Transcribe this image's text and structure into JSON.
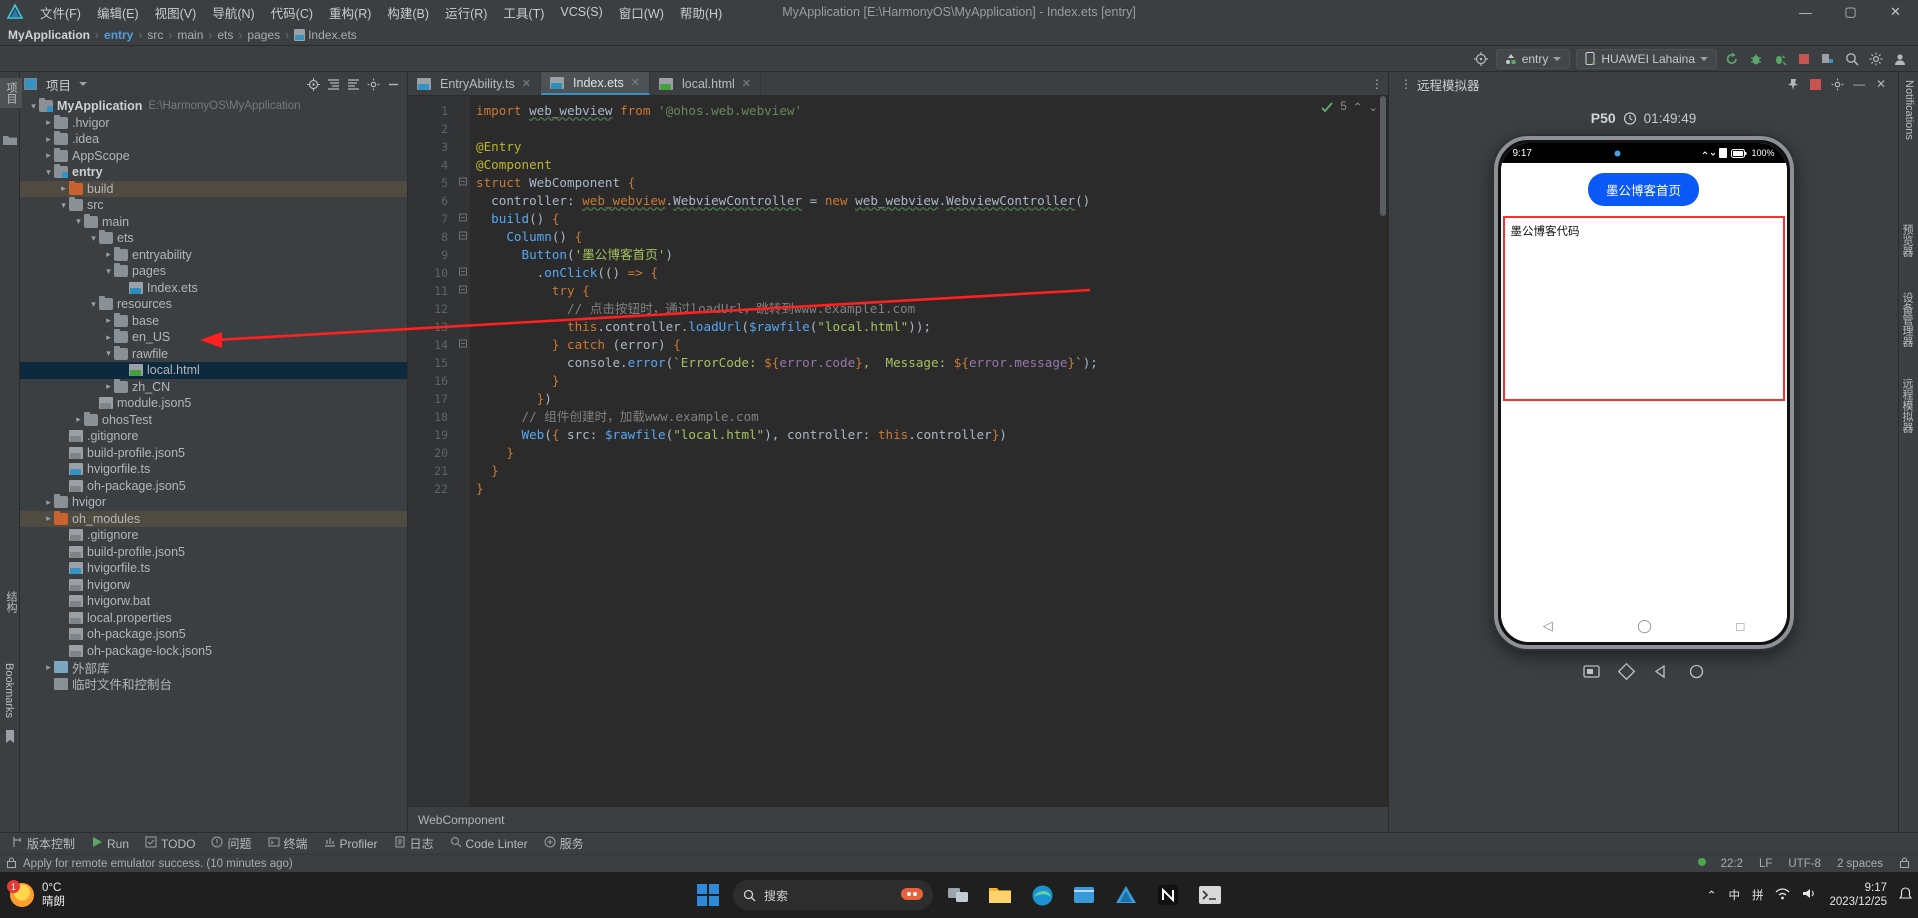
{
  "window": {
    "title": "MyApplication [E:\\HarmonyOS\\MyApplication] - Index.ets [entry]",
    "minimize": "—",
    "maximize": "▢",
    "close": "✕"
  },
  "menubar": {
    "logo_name": "deveco-logo-icon",
    "items": [
      {
        "label": "文件(F)"
      },
      {
        "label": "编辑(E)"
      },
      {
        "label": "视图(V)"
      },
      {
        "label": "导航(N)"
      },
      {
        "label": "代码(C)"
      },
      {
        "label": "重构(R)"
      },
      {
        "label": "构建(B)"
      },
      {
        "label": "运行(R)"
      },
      {
        "label": "工具(T)"
      },
      {
        "label": "VCS(S)"
      },
      {
        "label": "窗口(W)"
      },
      {
        "label": "帮助(H)"
      }
    ]
  },
  "breadcrumb": {
    "items": [
      "MyApplication",
      "entry",
      "src",
      "main",
      "ets",
      "pages",
      "Index.ets"
    ],
    "separator": "›"
  },
  "toolbar": {
    "run_config": "entry",
    "device": "HUAWEI Lahaina",
    "icons": [
      "target-icon",
      "run-icon",
      "debug-icon",
      "profile-run-icon",
      "stop-icon",
      "device-manager-icon",
      "search-icon",
      "settings-icon",
      "account-icon"
    ]
  },
  "left_strip": {
    "tab_project": "项目",
    "bookmarks": "Bookmarks",
    "structure": "结构"
  },
  "right_strip": {
    "notifications": "Notifications",
    "previewer": "预览器",
    "device_mgr": "设备管理器",
    "remote_emulator": "远程模拟器"
  },
  "project_panel": {
    "title": "项目",
    "header_icons": [
      "locate-icon",
      "collapse-all-icon",
      "expand-all-icon",
      "settings-icon",
      "hide-icon"
    ],
    "tree": [
      {
        "depth": 0,
        "arrow": "v",
        "icon": "folder-module",
        "label": "MyApplication",
        "bold": true,
        "path": "E:\\HarmonyOS\\MyApplication"
      },
      {
        "depth": 1,
        "arrow": ">",
        "icon": "folder",
        "label": ".hvigor"
      },
      {
        "depth": 1,
        "arrow": ">",
        "icon": "folder",
        "label": ".idea"
      },
      {
        "depth": 1,
        "arrow": ">",
        "icon": "folder",
        "label": "AppScope"
      },
      {
        "depth": 1,
        "arrow": "v",
        "icon": "folder-module",
        "label": "entry",
        "bold": true
      },
      {
        "depth": 2,
        "arrow": ">",
        "icon": "folder-orange",
        "label": "build",
        "highlight": true
      },
      {
        "depth": 2,
        "arrow": "v",
        "icon": "folder",
        "label": "src"
      },
      {
        "depth": 3,
        "arrow": "v",
        "icon": "folder",
        "label": "main"
      },
      {
        "depth": 4,
        "arrow": "v",
        "icon": "folder",
        "label": "ets"
      },
      {
        "depth": 5,
        "arrow": ">",
        "icon": "folder",
        "label": "entryability"
      },
      {
        "depth": 5,
        "arrow": "v",
        "icon": "folder",
        "label": "pages"
      },
      {
        "depth": 6,
        "arrow": "",
        "icon": "file-ets",
        "label": "Index.ets"
      },
      {
        "depth": 4,
        "arrow": "v",
        "icon": "folder",
        "label": "resources"
      },
      {
        "depth": 5,
        "arrow": ">",
        "icon": "folder",
        "label": "base"
      },
      {
        "depth": 5,
        "arrow": ">",
        "icon": "folder",
        "label": "en_US"
      },
      {
        "depth": 5,
        "arrow": "v",
        "icon": "folder",
        "label": "rawfile"
      },
      {
        "depth": 6,
        "arrow": "",
        "icon": "file-html",
        "label": "local.html",
        "selected": true
      },
      {
        "depth": 5,
        "arrow": ">",
        "icon": "folder",
        "label": "zh_CN"
      },
      {
        "depth": 4,
        "arrow": "",
        "icon": "file-json",
        "label": "module.json5"
      },
      {
        "depth": 3,
        "arrow": ">",
        "icon": "folder",
        "label": "ohosTest"
      },
      {
        "depth": 2,
        "arrow": "",
        "icon": "file-json",
        "label": ".gitignore"
      },
      {
        "depth": 2,
        "arrow": "",
        "icon": "file-json",
        "label": "build-profile.json5"
      },
      {
        "depth": 2,
        "arrow": "",
        "icon": "file-ts",
        "label": "hvigorfile.ts"
      },
      {
        "depth": 2,
        "arrow": "",
        "icon": "file-json",
        "label": "oh-package.json5"
      },
      {
        "depth": 1,
        "arrow": ">",
        "icon": "folder",
        "label": "hvigor"
      },
      {
        "depth": 1,
        "arrow": ">",
        "icon": "folder-orange",
        "label": "oh_modules",
        "highlight": true
      },
      {
        "depth": 2,
        "arrow": "",
        "icon": "file-json",
        "label": ".gitignore"
      },
      {
        "depth": 2,
        "arrow": "",
        "icon": "file-json",
        "label": "build-profile.json5"
      },
      {
        "depth": 2,
        "arrow": "",
        "icon": "file-ts",
        "label": "hvigorfile.ts"
      },
      {
        "depth": 2,
        "arrow": "",
        "icon": "file-plain",
        "label": "hvigorw"
      },
      {
        "depth": 2,
        "arrow": "",
        "icon": "file-plain",
        "label": "hvigorw.bat"
      },
      {
        "depth": 2,
        "arrow": "",
        "icon": "file-plain",
        "label": "local.properties"
      },
      {
        "depth": 2,
        "arrow": "",
        "icon": "file-json",
        "label": "oh-package.json5"
      },
      {
        "depth": 2,
        "arrow": "",
        "icon": "file-json",
        "label": "oh-package-lock.json5"
      },
      {
        "depth": 1,
        "arrow": ">",
        "icon": "lib",
        "label": "外部库"
      },
      {
        "depth": 1,
        "arrow": "",
        "icon": "scratch",
        "label": "临时文件和控制台"
      }
    ]
  },
  "editor": {
    "tabs": [
      {
        "label": "EntryAbility.ts",
        "icon": "file-ts",
        "active": false,
        "close": "✕"
      },
      {
        "label": "Index.ets",
        "icon": "file-ets",
        "active": true,
        "close": "✕"
      },
      {
        "label": "local.html",
        "icon": "file-html",
        "active": false,
        "close": "✕"
      }
    ],
    "inspection": {
      "count": "5",
      "up": "⌃",
      "down": "⌄"
    },
    "line_numbers": [
      "1",
      "2",
      "3",
      "4",
      "5",
      "6",
      "7",
      "8",
      "9",
      "10",
      "11",
      "12",
      "13",
      "14",
      "15",
      "16",
      "17",
      "18",
      "19",
      "20",
      "21",
      "22"
    ],
    "code_lines": [
      "import web_webview from '@ohos.web.webview'",
      "",
      "@Entry",
      "@Component",
      "struct WebComponent {",
      "  controller: web_webview.WebviewController = new web_webview.WebviewController()",
      "  build() {",
      "    Column() {",
      "      Button('墨公博客首页')",
      "        .onClick(() => {",
      "          try {",
      "            // 点击按钮时，通过loadUrl，跳转到www.example1.com",
      "            this.controller.loadUrl($rawfile(\"local.html\"));",
      "          } catch (error) {",
      "            console.error(`ErrorCode: ${error.code},  Message: ${error.message}`);",
      "          }",
      "        })",
      "      // 组件创建时，加载www.example.com",
      "      Web({ src: $rawfile(\"local.html\"), controller: this.controller})",
      "    }",
      "  }",
      "}"
    ],
    "breadcrumb_bottom": "WebComponent"
  },
  "emulator": {
    "panel_title": "远程模拟器",
    "device_name": "P50",
    "session_time": "01:49:49",
    "phone": {
      "status_time": "9:17",
      "battery": "100%",
      "button_label": "墨公博客首页",
      "webview_text": "墨公博客代码",
      "nav": [
        "◁",
        "◯",
        "□"
      ]
    },
    "tool_icons": [
      "screenshot-icon",
      "rotate-icon",
      "back-icon",
      "home-icon"
    ]
  },
  "bottom_bar": {
    "items": [
      {
        "label": "版本控制",
        "icon": "vcs-icon"
      },
      {
        "label": "Run",
        "icon": "run-icon"
      },
      {
        "label": "TODO",
        "icon": "todo-icon"
      },
      {
        "label": "问题",
        "icon": "problems-icon"
      },
      {
        "label": "终端",
        "icon": "terminal-icon"
      },
      {
        "label": "Profiler",
        "icon": "profiler-icon"
      },
      {
        "label": "日志",
        "icon": "log-icon"
      },
      {
        "label": "Code Linter",
        "icon": "linter-icon"
      },
      {
        "label": "服务",
        "icon": "services-icon"
      }
    ]
  },
  "status_bar": {
    "message": "Apply for remote emulator success. (10 minutes ago)",
    "right": [
      "22:2",
      "LF",
      "UTF-8",
      "2 spaces"
    ],
    "lock_icon": "lock-icon",
    "status_dot_color": "#4aa84a"
  },
  "taskbar": {
    "weather_temp": "0°C",
    "weather_desc": "晴朗",
    "weather_badge": "1",
    "search_placeholder": "搜索",
    "clock_time": "9:17",
    "clock_date": "2023/12/25",
    "ime_lang": "中",
    "ime_mode": "拼",
    "apps": [
      "windows-icon",
      "search-icon",
      "widgets-icon",
      "taskview-icon",
      "explorer-icon",
      "edge-icon",
      "store-icon",
      "deveco-icon",
      "notion-icon",
      "terminal-icon"
    ],
    "tray": [
      "chevron-up-icon",
      "ime-icon",
      "pinyin-icon",
      "network-icon",
      "volume-icon"
    ]
  }
}
